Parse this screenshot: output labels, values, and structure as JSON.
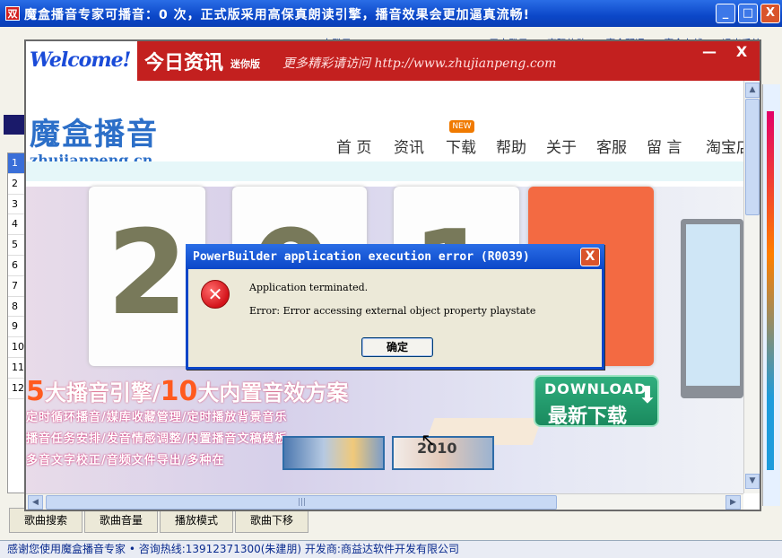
{
  "main_window": {
    "title": "魔盒播音专家可播音：0 次，正式版采用高保真朗读引擎，播音效果会更加逼真流畅!",
    "app_icon": "双",
    "buttons": {
      "minimize": "_",
      "maximize": "□",
      "close": "X"
    }
  },
  "top_links": [
    "未登录",
    "用户登录",
    "密码修改",
    "魔盒翻译",
    "魔盒在线",
    "退出系统"
  ],
  "playlist": {
    "row_numbers": [
      "1",
      "2",
      "3",
      "4",
      "5",
      "6",
      "7",
      "8",
      "9",
      "10",
      "11",
      "12"
    ]
  },
  "bottom_buttons": [
    "歌曲搜索",
    "歌曲音量",
    "播放模式",
    "歌曲下移"
  ],
  "status_bar": "感谢您使用魔盒播音专家 • 咨询热线:13912371300(朱建朋) 开发商:商益达软件开发有限公司",
  "news_window": {
    "logo_text": "Welcome!",
    "brand": "今日资讯",
    "edition": "迷你版",
    "more_text": "更多精彩请访问 http://www.zhujianpeng.com",
    "buttons": {
      "minimize": "—",
      "close": "X"
    }
  },
  "website": {
    "logo_cn": "魔盒播音",
    "logo_url": "zhujianpeng.cn",
    "nav": [
      "首 页",
      "资讯",
      "下载",
      "帮助",
      "关于",
      "客服",
      "留 言",
      "淘宝店"
    ],
    "new_badge": "NEW",
    "banner": {
      "calendar_digits": [
        "2",
        "0",
        "1"
      ],
      "slogan_num1": "5",
      "slogan_text1": "大播音引擎/",
      "slogan_num2": "10",
      "slogan_text2": "大内置音效方案",
      "feature_lines": [
        "定时循环播音/媒库收藏管理/定时播放背景音乐",
        "播音任务安排/发音情感调整/内置播音文稿模板",
        "多音文字校正/音频文件导出/多种在"
      ],
      "download_en": "DOWNLOAD",
      "download_cn": "最新下载",
      "thumb_year": "2010"
    }
  },
  "error_dialog": {
    "title": "PowerBuilder application execution error (R0039)",
    "close": "X",
    "icon": "error-icon",
    "line1": "Application terminated.",
    "line2": "Error: Error accessing external object property playstate",
    "ok_label": "确定"
  },
  "colors": {
    "titlebar_blue": "#0b47c8",
    "news_header_red": "#c3201f",
    "error_red": "#d3131a",
    "slogan_orange": "#ff5a1f",
    "download_green": "#1a8a5e"
  }
}
